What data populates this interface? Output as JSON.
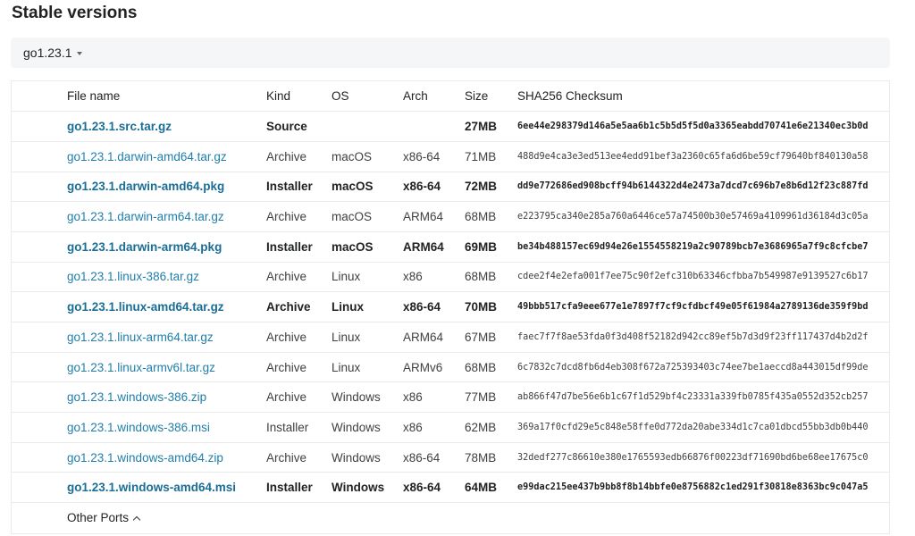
{
  "section_title": "Stable versions",
  "version_selector": {
    "selected": "go1.23.1"
  },
  "table": {
    "headers": [
      "File name",
      "Kind",
      "OS",
      "Arch",
      "Size",
      "SHA256 Checksum"
    ],
    "rows": [
      {
        "file": "go1.23.1.src.tar.gz",
        "kind": "Source",
        "os": "",
        "arch": "",
        "size": "27MB",
        "sha": "6ee44e298379d146a5e5aa6b1c5b5d5f5d0a3365eabdd70741e6e21340ec3b0d",
        "featured": true
      },
      {
        "file": "go1.23.1.darwin-amd64.tar.gz",
        "kind": "Archive",
        "os": "macOS",
        "arch": "x86-64",
        "size": "71MB",
        "sha": "488d9e4ca3e3ed513ee4edd91bef3a2360c65fa6d6be59cf79640bf840130a58",
        "featured": false
      },
      {
        "file": "go1.23.1.darwin-amd64.pkg",
        "kind": "Installer",
        "os": "macOS",
        "arch": "x86-64",
        "size": "72MB",
        "sha": "dd9e772686ed908bcff94b6144322d4e2473a7dcd7c696b7e8b6d12f23c887fd",
        "featured": true
      },
      {
        "file": "go1.23.1.darwin-arm64.tar.gz",
        "kind": "Archive",
        "os": "macOS",
        "arch": "ARM64",
        "size": "68MB",
        "sha": "e223795ca340e285a760a6446ce57a74500b30e57469a4109961d36184d3c05a",
        "featured": false
      },
      {
        "file": "go1.23.1.darwin-arm64.pkg",
        "kind": "Installer",
        "os": "macOS",
        "arch": "ARM64",
        "size": "69MB",
        "sha": "be34b488157ec69d94e26e1554558219a2c90789bcb7e3686965a7f9c8cfcbe7",
        "featured": true
      },
      {
        "file": "go1.23.1.linux-386.tar.gz",
        "kind": "Archive",
        "os": "Linux",
        "arch": "x86",
        "size": "68MB",
        "sha": "cdee2f4e2efa001f7ee75c90f2efc310b63346cfbba7b549987e9139527c6b17",
        "featured": false
      },
      {
        "file": "go1.23.1.linux-amd64.tar.gz",
        "kind": "Archive",
        "os": "Linux",
        "arch": "x86-64",
        "size": "70MB",
        "sha": "49bbb517cfa9eee677e1e7897f7cf9cfdbcf49e05f61984a2789136de359f9bd",
        "featured": true
      },
      {
        "file": "go1.23.1.linux-arm64.tar.gz",
        "kind": "Archive",
        "os": "Linux",
        "arch": "ARM64",
        "size": "67MB",
        "sha": "faec7f7f8ae53fda0f3d408f52182d942cc89ef5b7d3d9f23ff117437d4b2d2f",
        "featured": false
      },
      {
        "file": "go1.23.1.linux-armv6l.tar.gz",
        "kind": "Archive",
        "os": "Linux",
        "arch": "ARMv6",
        "size": "68MB",
        "sha": "6c7832c7dcd8fb6d4eb308f672a725393403c74ee7be1aeccd8a443015df99de",
        "featured": false
      },
      {
        "file": "go1.23.1.windows-386.zip",
        "kind": "Archive",
        "os": "Windows",
        "arch": "x86",
        "size": "77MB",
        "sha": "ab866f47d7be56e6b1c67f1d529bf4c23331a339fb0785f435a0552d352cb257",
        "featured": false
      },
      {
        "file": "go1.23.1.windows-386.msi",
        "kind": "Installer",
        "os": "Windows",
        "arch": "x86",
        "size": "62MB",
        "sha": "369a17f0cfd29e5c848e58ffe0d772da20abe334d1c7ca01dbcd55bb3db0b440",
        "featured": false
      },
      {
        "file": "go1.23.1.windows-amd64.zip",
        "kind": "Archive",
        "os": "Windows",
        "arch": "x86-64",
        "size": "78MB",
        "sha": "32dedf277c86610e380e1765593edb66876f00223df71690bd6be68ee17675c0",
        "featured": false
      },
      {
        "file": "go1.23.1.windows-amd64.msi",
        "kind": "Installer",
        "os": "Windows",
        "arch": "x86-64",
        "size": "64MB",
        "sha": "e99dac215ee437b9bb8f8b14bbfe0e8756882c1ed291f30818e8363bc9c047a5",
        "featured": true
      }
    ]
  },
  "other_ports": {
    "label": "Other Ports",
    "icon": "chevron-up-icon"
  },
  "colors": {
    "link": "#1f7eaa",
    "link_featured": "#1a6e96",
    "bar_bg": "#f5f6f7",
    "border": "#e8eaec"
  }
}
